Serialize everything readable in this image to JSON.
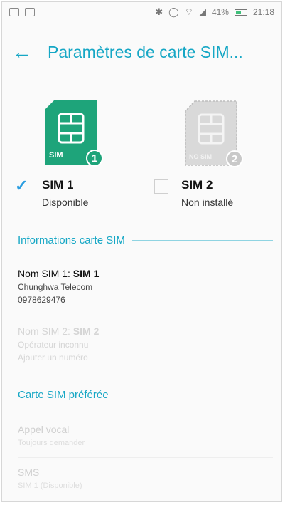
{
  "status_bar": {
    "battery": "41%",
    "time": "21:18",
    "left_icons": [
      "image-icon",
      "message-icon"
    ],
    "right_icons": [
      "bluetooth-icon",
      "sync-icon",
      "wifi-icon",
      "signal-icon",
      "battery-icon"
    ]
  },
  "header": {
    "back_icon": "arrow-left-icon",
    "title": "Paramètres de carte SIM..."
  },
  "sims": [
    {
      "chip_label": "SIM",
      "badge": "1",
      "name": "SIM 1",
      "state": "Disponible",
      "checked": true,
      "color": "#1ea47a"
    },
    {
      "chip_label": "NO SIM",
      "badge": "2",
      "name": "SIM 2",
      "state": "Non installé",
      "checked": false,
      "color": "#cfcfcf"
    }
  ],
  "info_section": {
    "title": "Informations carte SIM",
    "sim1": {
      "label_prefix": "Nom SIM 1: ",
      "label_value": "SIM 1",
      "operator": "Chunghwa Telecom",
      "number": "0978629476"
    },
    "sim2": {
      "label_prefix": "Nom SIM 2: ",
      "label_value": "SIM 2",
      "operator": "Opérateur inconnu",
      "number": "Ajouter un numéro"
    }
  },
  "preferred_section": {
    "title": "Carte SIM préférée",
    "items": [
      {
        "label": "Appel vocal",
        "value": "Toujours demander"
      },
      {
        "label": "SMS",
        "value": "SIM 1 (Disponible)"
      }
    ]
  },
  "colors": {
    "accent": "#16a7c5",
    "sim_active": "#1ea47a",
    "checkbox": "#2a9de0"
  }
}
